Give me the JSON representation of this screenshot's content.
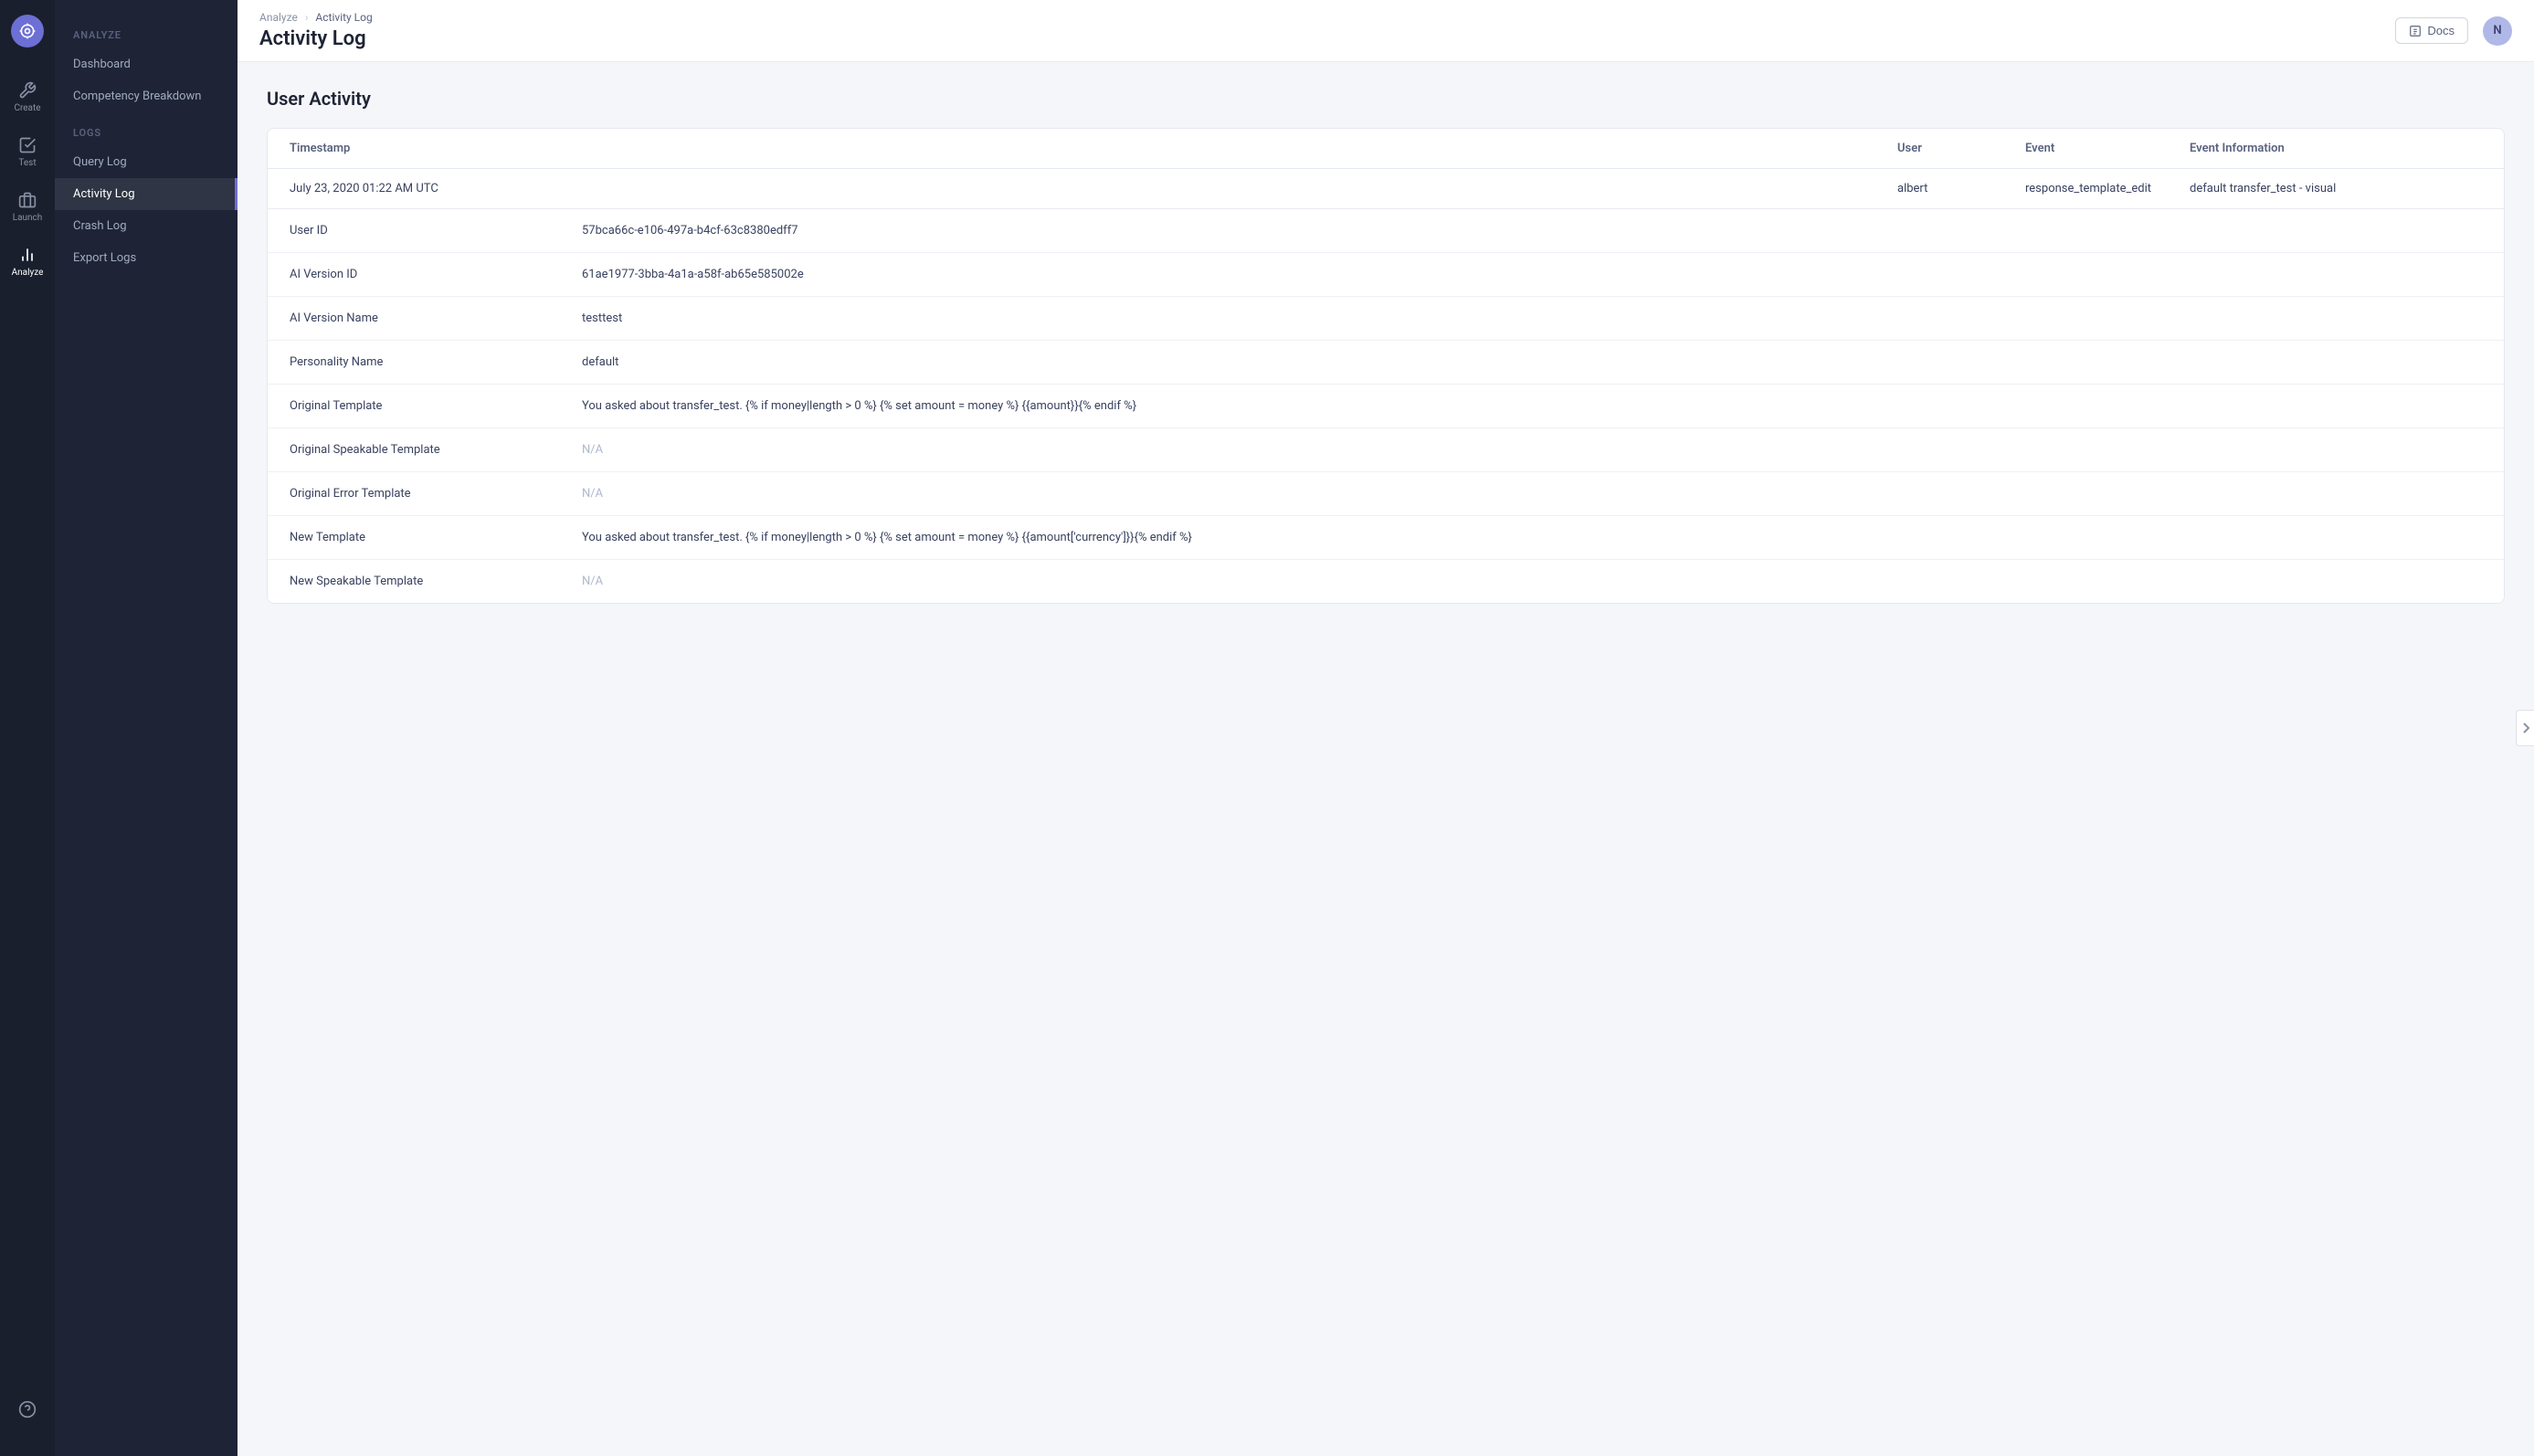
{
  "app": {
    "logo_symbol": "◎"
  },
  "icon_nav": [
    {
      "id": "create",
      "label": "Create",
      "icon": "wrench"
    },
    {
      "id": "test",
      "label": "Test",
      "icon": "check-square"
    },
    {
      "id": "launch",
      "label": "Launch",
      "icon": "rocket"
    },
    {
      "id": "analyze",
      "label": "Analyze",
      "icon": "bar-chart",
      "active": true
    }
  ],
  "left_nav": {
    "section_analyze": "ANALYZE",
    "items_analyze": [
      {
        "id": "dashboard",
        "label": "Dashboard",
        "active": false
      },
      {
        "id": "competency-breakdown",
        "label": "Competency Breakdown",
        "active": false
      }
    ],
    "section_logs": "LOGS",
    "items_logs": [
      {
        "id": "query-log",
        "label": "Query Log",
        "active": false
      },
      {
        "id": "activity-log",
        "label": "Activity Log",
        "active": true
      },
      {
        "id": "crash-log",
        "label": "Crash Log",
        "active": false
      },
      {
        "id": "export-logs",
        "label": "Export Logs",
        "active": false
      }
    ]
  },
  "header": {
    "breadcrumb_root": "Analyze",
    "breadcrumb_current": "Activity Log",
    "page_title": "Activity Log",
    "docs_label": "Docs",
    "user_initial": "N"
  },
  "main": {
    "section_title": "User Activity",
    "table_columns": {
      "timestamp": "Timestamp",
      "user": "User",
      "event": "Event",
      "event_info": "Event Information"
    },
    "log_entry": {
      "timestamp": "July 23, 2020 01:22 AM UTC",
      "user": "albert",
      "event": "response_template_edit",
      "event_info": "default transfer_test - visual"
    },
    "detail_rows": [
      {
        "label": "User ID",
        "value": "57bca66c-e106-497a-b4cf-63c8380edff7",
        "na": false
      },
      {
        "label": "AI Version ID",
        "value": "61ae1977-3bba-4a1a-a58f-ab65e585002e",
        "na": false
      },
      {
        "label": "AI Version Name",
        "value": "testtest",
        "na": false
      },
      {
        "label": "Personality Name",
        "value": "default",
        "na": false
      },
      {
        "label": "Original Template",
        "value": "You asked about transfer_test. {% if money|length > 0 %} {% set amount = money %} {{amount}}{% endif %}",
        "na": false
      },
      {
        "label": "Original Speakable Template",
        "value": "N/A",
        "na": true
      },
      {
        "label": "Original Error Template",
        "value": "N/A",
        "na": true
      },
      {
        "label": "New Template",
        "value": "You asked about transfer_test. {% if money|length > 0 %} {% set amount = money %} {{amount['currency']}}{% endif %}",
        "na": false
      },
      {
        "label": "New Speakable Template",
        "value": "N/A",
        "na": true
      }
    ]
  }
}
